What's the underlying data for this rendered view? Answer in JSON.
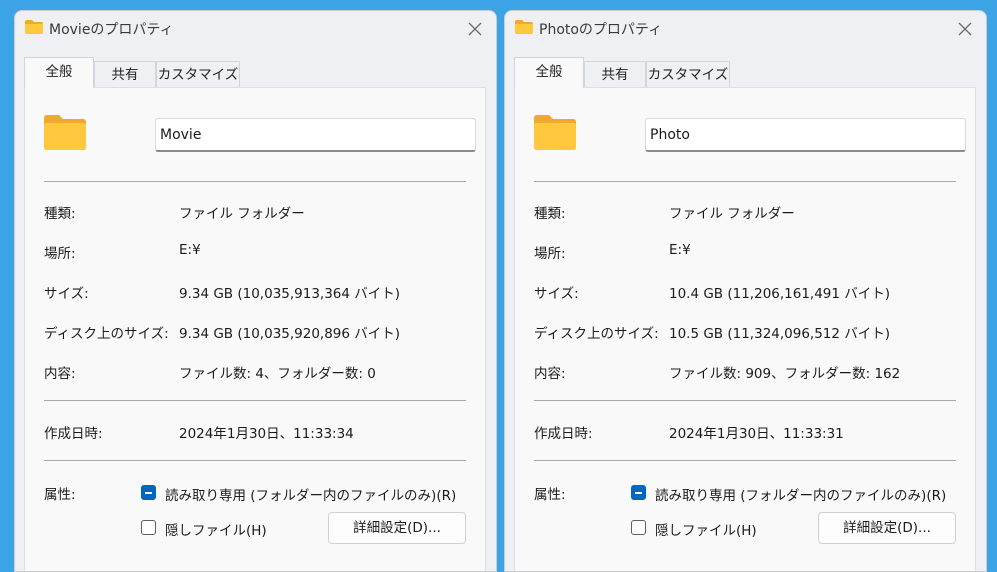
{
  "windows": [
    {
      "title": "Movieのプロパティ",
      "tabs": [
        "全般",
        "共有",
        "カスタマイズ"
      ],
      "active_tab": "全般",
      "name_value": "Movie",
      "type_label": "種類:",
      "type_value": "ファイル フォルダー",
      "location_label": "場所:",
      "location_value": "E:¥",
      "size_label": "サイズ:",
      "size_value": "9.34 GB (10,035,913,364 バイト)",
      "disk_size_label": "ディスク上のサイズ:",
      "disk_size_value": "9.34 GB (10,035,920,896 バイト)",
      "contents_label": "内容:",
      "contents_value": "ファイル数: 4、フォルダー数: 0",
      "created_label": "作成日時:",
      "created_value": "2024年1月30日、11:33:34",
      "attributes_label": "属性:",
      "readonly_label": "読み取り専用 (フォルダー内のファイルのみ)(R)",
      "readonly_state": "indeterminate",
      "hidden_label": "隠しファイル(H)",
      "hidden_state": "unchecked",
      "advanced_button": "詳細設定(D)..."
    },
    {
      "title": "Photoのプロパティ",
      "tabs": [
        "全般",
        "共有",
        "カスタマイズ"
      ],
      "active_tab": "全般",
      "name_value": "Photo",
      "type_label": "種類:",
      "type_value": "ファイル フォルダー",
      "location_label": "場所:",
      "location_value": "E:¥",
      "size_label": "サイズ:",
      "size_value": "10.4 GB (11,206,161,491 バイト)",
      "disk_size_label": "ディスク上のサイズ:",
      "disk_size_value": "10.5 GB (11,324,096,512 バイト)",
      "contents_label": "内容:",
      "contents_value": "ファイル数: 909、フォルダー数: 162",
      "created_label": "作成日時:",
      "created_value": "2024年1月30日、11:33:31",
      "attributes_label": "属性:",
      "readonly_label": "読み取り専用 (フォルダー内のファイルのみ)(R)",
      "readonly_state": "indeterminate",
      "hidden_label": "隠しファイル(H)",
      "hidden_state": "unchecked",
      "advanced_button": "詳細設定(D)..."
    }
  ],
  "icons": {
    "title": "folder-icon",
    "close": "close-icon",
    "large": "large-folder-icon"
  },
  "colors": {
    "desktop": "#3ba3e6",
    "folder_body": "#ffc83d",
    "folder_back": "#f0a830",
    "checkbox_accent": "#0067c0"
  }
}
